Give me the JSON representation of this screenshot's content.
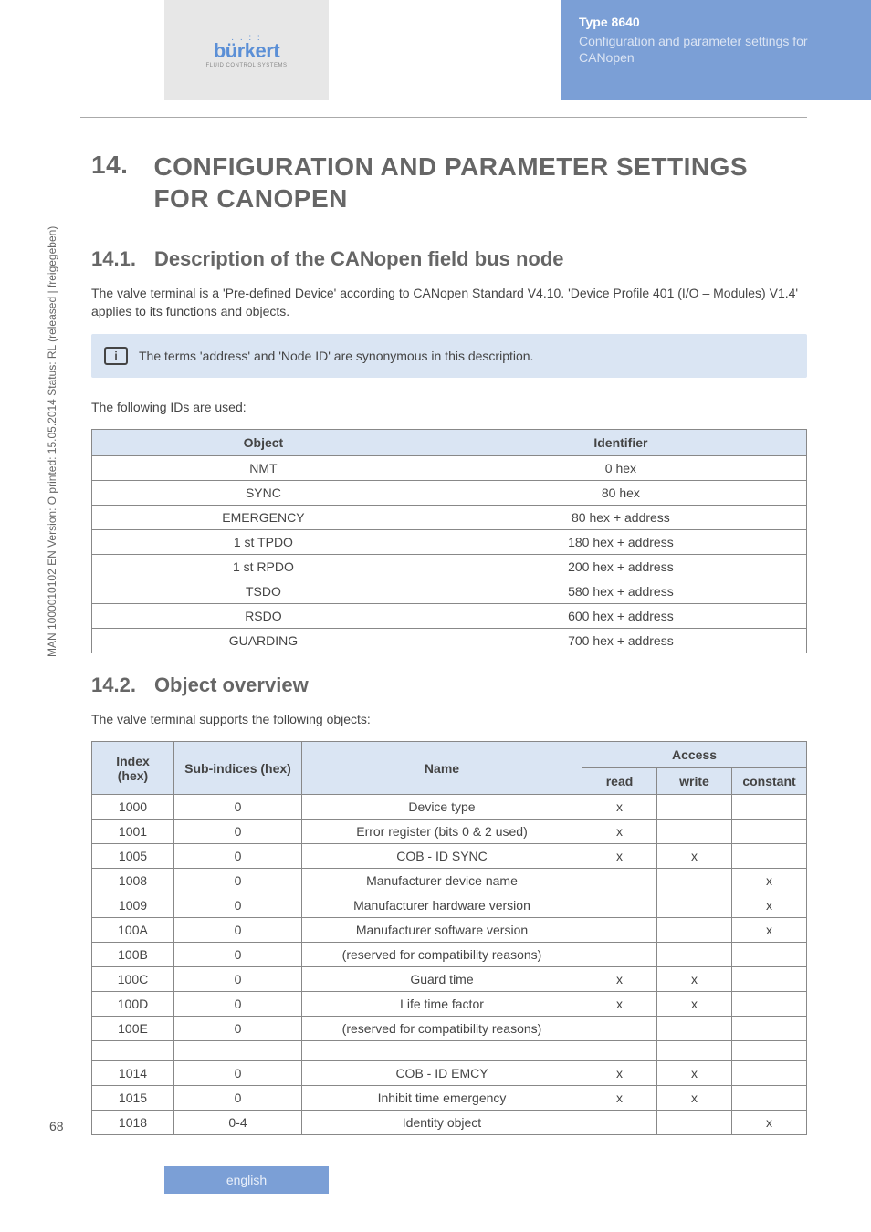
{
  "header": {
    "type_label": "Type 8640",
    "subtitle": "Configuration and parameter settings for CANopen",
    "logo_text": "bürkert",
    "logo_sub": "FLUID CONTROL SYSTEMS"
  },
  "section": {
    "num": "14.",
    "title": "CONFIGURATION AND PARAMETER SETTINGS FOR CANOPEN"
  },
  "sub1": {
    "num": "14.1.",
    "title": "Description of the CANopen field bus node",
    "para": "The valve terminal is a 'Pre-defined Device' according to CANopen Standard V4.10. 'Device Profile 401 (I/O – Modules) V1.4' applies to its functions and objects.",
    "info": "The terms 'address' and 'Node ID' are synonymous in this description.",
    "ids_intro": "The following IDs are used:"
  },
  "table1": {
    "headers": [
      "Object",
      "Identifier"
    ],
    "rows": [
      [
        "NMT",
        "0 hex"
      ],
      [
        "SYNC",
        "80 hex"
      ],
      [
        "EMERGENCY",
        "80 hex + address"
      ],
      [
        "1 st TPDO",
        "180 hex + address"
      ],
      [
        "1 st RPDO",
        "200 hex + address"
      ],
      [
        "TSDO",
        "580 hex + address"
      ],
      [
        "RSDO",
        "600 hex + address"
      ],
      [
        "GUARDING",
        "700 hex + address"
      ]
    ]
  },
  "sub2": {
    "num": "14.2.",
    "title": "Object overview",
    "para": "The valve terminal supports the following objects:"
  },
  "table2": {
    "headers": {
      "index": "Index (hex)",
      "sub": "Sub-indices (hex)",
      "name": "Name",
      "access": "Access",
      "read": "read",
      "write": "write",
      "constant": "constant"
    },
    "rows": [
      {
        "index": "1000",
        "sub": "0",
        "name": "Device type",
        "read": "x",
        "write": "",
        "constant": ""
      },
      {
        "index": "1001",
        "sub": "0",
        "name": "Error register (bits 0 & 2 used)",
        "read": "x",
        "write": "",
        "constant": ""
      },
      {
        "index": "1005",
        "sub": "0",
        "name": "COB - ID SYNC",
        "read": "x",
        "write": "x",
        "constant": ""
      },
      {
        "index": "1008",
        "sub": "0",
        "name": "Manufacturer device name",
        "read": "",
        "write": "",
        "constant": "x"
      },
      {
        "index": "1009",
        "sub": "0",
        "name": "Manufacturer hardware version",
        "read": "",
        "write": "",
        "constant": "x"
      },
      {
        "index": "100A",
        "sub": "0",
        "name": "Manufacturer software version",
        "read": "",
        "write": "",
        "constant": "x"
      },
      {
        "index": "100B",
        "sub": "0",
        "name": "(reserved for compatibility reasons)",
        "read": "",
        "write": "",
        "constant": ""
      },
      {
        "index": "100C",
        "sub": "0",
        "name": "Guard time",
        "read": "x",
        "write": "x",
        "constant": ""
      },
      {
        "index": "100D",
        "sub": "0",
        "name": "Life time factor",
        "read": "x",
        "write": "x",
        "constant": ""
      },
      {
        "index": "100E",
        "sub": "0",
        "name": "(reserved for compatibility reasons)",
        "read": "",
        "write": "",
        "constant": ""
      },
      {
        "index": "",
        "sub": "",
        "name": "",
        "read": "",
        "write": "",
        "constant": ""
      },
      {
        "index": "1014",
        "sub": "0",
        "name": "COB - ID EMCY",
        "read": "x",
        "write": "x",
        "constant": ""
      },
      {
        "index": "1015",
        "sub": "0",
        "name": "Inhibit time emergency",
        "read": "x",
        "write": "x",
        "constant": ""
      },
      {
        "index": "1018",
        "sub": "0-4",
        "name": "Identity object",
        "read": "",
        "write": "",
        "constant": "x"
      }
    ]
  },
  "page_num": "68",
  "side": "MAN 1000010102 EN Version: O  printed: 15.05.2014 Status: RL (released | freigegeben)",
  "bottom_tab": "english",
  "chart_data": {
    "type": "table",
    "tables": [
      {
        "title": "CANopen IDs",
        "columns": [
          "Object",
          "Identifier"
        ],
        "rows": [
          [
            "NMT",
            "0 hex"
          ],
          [
            "SYNC",
            "80 hex"
          ],
          [
            "EMERGENCY",
            "80 hex + address"
          ],
          [
            "1 st TPDO",
            "180 hex + address"
          ],
          [
            "1 st RPDO",
            "200 hex + address"
          ],
          [
            "TSDO",
            "580 hex + address"
          ],
          [
            "RSDO",
            "600 hex + address"
          ],
          [
            "GUARDING",
            "700 hex + address"
          ]
        ]
      },
      {
        "title": "Object overview",
        "columns": [
          "Index (hex)",
          "Sub-indices (hex)",
          "Name",
          "read",
          "write",
          "constant"
        ],
        "rows": [
          [
            "1000",
            "0",
            "Device type",
            "x",
            "",
            ""
          ],
          [
            "1001",
            "0",
            "Error register (bits 0 & 2 used)",
            "x",
            "",
            ""
          ],
          [
            "1005",
            "0",
            "COB - ID SYNC",
            "x",
            "x",
            ""
          ],
          [
            "1008",
            "0",
            "Manufacturer device name",
            "",
            "",
            "x"
          ],
          [
            "1009",
            "0",
            "Manufacturer hardware version",
            "",
            "",
            "x"
          ],
          [
            "100A",
            "0",
            "Manufacturer software version",
            "",
            "",
            "x"
          ],
          [
            "100B",
            "0",
            "(reserved for compatibility reasons)",
            "",
            "",
            ""
          ],
          [
            "100C",
            "0",
            "Guard time",
            "x",
            "x",
            ""
          ],
          [
            "100D",
            "0",
            "Life time factor",
            "x",
            "x",
            ""
          ],
          [
            "100E",
            "0",
            "(reserved for compatibility reasons)",
            "",
            "",
            ""
          ],
          [
            "1014",
            "0",
            "COB - ID EMCY",
            "x",
            "x",
            ""
          ],
          [
            "1015",
            "0",
            "Inhibit time emergency",
            "x",
            "x",
            ""
          ],
          [
            "1018",
            "0-4",
            "Identity object",
            "",
            "",
            "x"
          ]
        ]
      }
    ]
  }
}
